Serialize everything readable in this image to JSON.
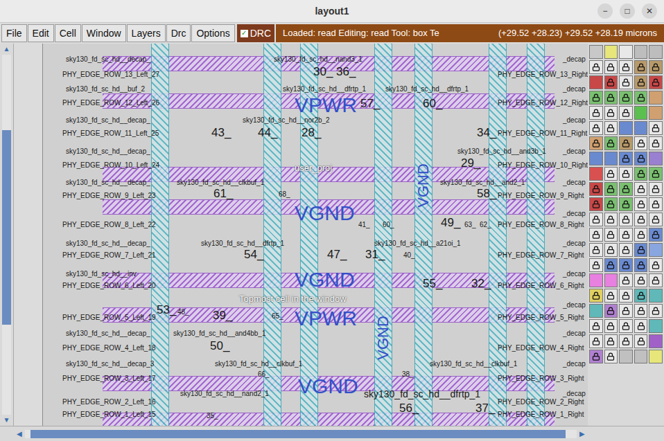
{
  "window": {
    "title": "layout1",
    "controls": [
      "−",
      "□",
      "✕"
    ]
  },
  "menu": [
    "File",
    "Edit",
    "Cell",
    "Window",
    "Layers",
    "Drc",
    "Options"
  ],
  "drc_toggle": {
    "label": "DRC",
    "checked": true,
    "check": "✓"
  },
  "status": {
    "left": "Loaded: read Editing: read Tool: box  Te",
    "right": "(+29.52 +28.23) +29.52 +28.19 microns"
  },
  "vertical_scroll": {
    "up": "▲",
    "down": "▼",
    "thumb_start": 0.21,
    "thumb_size": 0.54
  },
  "horizontal_scroll": {
    "left": "◀",
    "right": "▶",
    "thumb_start": 0.01,
    "thumb_size": 0.97
  },
  "labels": [
    {
      "text": "sky130_fd_sc_hd__decap_",
      "kind": "cell"
    },
    {
      "text": "sky130_fd_sc_hd__nand3_1",
      "kind": "cell"
    },
    {
      "text": "_decap",
      "kind": "cell"
    },
    {
      "text": "30_",
      "kind": "number"
    },
    {
      "text": "36_",
      "kind": "number"
    },
    {
      "text": "PHY_EDGE_ROW_13_Left_27",
      "kind": "edge"
    },
    {
      "text": "PHY_EDGE_ROW_13_Right",
      "kind": "edge"
    },
    {
      "text": "sky130_fd_sc_hd__buf_2",
      "kind": "cell"
    },
    {
      "text": "sky130_fd_sc_hd__dfrtp_1",
      "kind": "cell"
    },
    {
      "text": "sky130_fd_sc_hd__dfrtp_1",
      "kind": "cell"
    },
    {
      "text": "_decap",
      "kind": "cell"
    },
    {
      "text": "VPWR",
      "kind": "power"
    },
    {
      "text": "57_",
      "kind": "number"
    },
    {
      "text": "60_",
      "kind": "number"
    },
    {
      "text": "PHY_EDGE_ROW_12_Left_26",
      "kind": "edge"
    },
    {
      "text": "PHY_EDGE_ROW_12_Right",
      "kind": "edge"
    },
    {
      "text": "sky130_fd_sc_hd__decap_",
      "kind": "cell"
    },
    {
      "text": "sky130_fd_sc_hd__nor2b_2",
      "kind": "cell"
    },
    {
      "text": "_decap",
      "kind": "cell"
    },
    {
      "text": "43_",
      "kind": "number"
    },
    {
      "text": "44_",
      "kind": "number"
    },
    {
      "text": "28_",
      "kind": "number"
    },
    {
      "text": "34_",
      "kind": "number"
    },
    {
      "text": "PHY_EDGE_ROW_11_Left_25",
      "kind": "edge"
    },
    {
      "text": "PHY_EDGE_ROW_11_Right",
      "kind": "edge"
    },
    {
      "text": "sky130_fd_sc_hd__decap_",
      "kind": "cell"
    },
    {
      "text": "sky130_fd_sc_hd__and3b_1",
      "kind": "cell"
    },
    {
      "text": "_decap",
      "kind": "cell"
    },
    {
      "text": "29_",
      "kind": "number"
    },
    {
      "text": "PHY_EDGE_ROW_10_Left_24",
      "kind": "edge"
    },
    {
      "text": "PHY_EDGE_ROW_10_Right",
      "kind": "edge"
    },
    {
      "text": "user_proj",
      "kind": "overlay"
    },
    {
      "text": "VGND",
      "kind": "power-vertical"
    },
    {
      "text": "sky130_fd_sc_hd__decap_",
      "kind": "cell"
    },
    {
      "text": "sky130_fd_sc_hd__clkbuf_1",
      "kind": "cell"
    },
    {
      "text": "sky130_fd_sc_hd__and2_1",
      "kind": "cell"
    },
    {
      "text": "_decap",
      "kind": "cell"
    },
    {
      "text": "61_",
      "kind": "number"
    },
    {
      "text": "68_",
      "kind": "small-number"
    },
    {
      "text": "58_",
      "kind": "number"
    },
    {
      "text": "PHY_EDGE_ROW_9_Left_23",
      "kind": "edge"
    },
    {
      "text": "PHY_EDGE_ROW_9_Right",
      "kind": "edge"
    },
    {
      "text": "VGND",
      "kind": "power"
    },
    {
      "text": "_decap",
      "kind": "cell"
    },
    {
      "text": "41_",
      "kind": "small-number"
    },
    {
      "text": "60_",
      "kind": "small-number"
    },
    {
      "text": "49_",
      "kind": "number"
    },
    {
      "text": "63_",
      "kind": "small-number"
    },
    {
      "text": "62_",
      "kind": "small-number"
    },
    {
      "text": "PHY_EDGE_ROW_8_Left_22",
      "kind": "edge"
    },
    {
      "text": "PHY_EDGE_ROW_8_Right",
      "kind": "edge"
    },
    {
      "text": "sky130_fd_sc_hd__decap_",
      "kind": "cell"
    },
    {
      "text": "sky130_fd_sc_hd__dfrtp_1",
      "kind": "cell"
    },
    {
      "text": "sky130_fd_sc_hd__a21oi_1",
      "kind": "cell"
    },
    {
      "text": "_decap",
      "kind": "cell"
    },
    {
      "text": "54_",
      "kind": "number"
    },
    {
      "text": "47_",
      "kind": "number"
    },
    {
      "text": "31_",
      "kind": "number"
    },
    {
      "text": "40_",
      "kind": "small-number"
    },
    {
      "text": "PHY_EDGE_ROW_7_Left_21",
      "kind": "edge"
    },
    {
      "text": "PHY_EDGE_ROW_7_Right",
      "kind": "edge"
    },
    {
      "text": "sky130_fd_sc_hd__inv",
      "kind": "cell"
    },
    {
      "text": "_decap",
      "kind": "cell"
    },
    {
      "text": "VGND",
      "kind": "power"
    },
    {
      "text": "55_",
      "kind": "number"
    },
    {
      "text": "32_",
      "kind": "number"
    },
    {
      "text": "PHY_EDGE_ROW_6_Left_20",
      "kind": "edge"
    },
    {
      "text": "PHY_EDGE_ROW_6_Right",
      "kind": "edge"
    },
    {
      "text": "Topmost cell in the window",
      "kind": "overlay"
    },
    {
      "text": "_decap",
      "kind": "cell"
    },
    {
      "text": "VPWR",
      "kind": "power"
    },
    {
      "text": "53_",
      "kind": "number"
    },
    {
      "text": "48_",
      "kind": "small-number"
    },
    {
      "text": "39_",
      "kind": "number"
    },
    {
      "text": "65_",
      "kind": "small-number"
    },
    {
      "text": "PHY_EDGE_ROW_5_Left_19",
      "kind": "edge"
    },
    {
      "text": "PHY_EDGE_ROW_5_Right",
      "kind": "edge"
    },
    {
      "text": "VGND",
      "kind": "power-vertical"
    },
    {
      "text": "sky130_fd_sc_hd__decap_",
      "kind": "cell"
    },
    {
      "text": "sky130_fd_sc_hd__and4bb_1",
      "kind": "cell"
    },
    {
      "text": "_decap",
      "kind": "cell"
    },
    {
      "text": "50_",
      "kind": "number"
    },
    {
      "text": "PHY_EDGE_ROW_4_Left_18",
      "kind": "edge"
    },
    {
      "text": "PHY_EDGE_ROW_4_Right",
      "kind": "edge"
    },
    {
      "text": "sky130_fd_sc_hd__decap_3",
      "kind": "cell"
    },
    {
      "text": "sky130_fd_sc_hd__clkbuf_1",
      "kind": "cell"
    },
    {
      "text": "sky130_fd_sc_hd__clkbuf_1",
      "kind": "cell"
    },
    {
      "text": "_decap",
      "kind": "cell"
    },
    {
      "text": "66_",
      "kind": "small-number"
    },
    {
      "text": "38_",
      "kind": "small-number"
    },
    {
      "text": "VGND",
      "kind": "power"
    },
    {
      "text": "PHY_EDGE_ROW_3_Left_17",
      "kind": "edge"
    },
    {
      "text": "PHY_EDGE_ROW_3_Right",
      "kind": "edge"
    },
    {
      "text": "sky130_fd_sc_hd__nand2_1",
      "kind": "cell"
    },
    {
      "text": "sky130_fd_sc_hd__dfrtp_1",
      "kind": "cell-large"
    },
    {
      "text": "_decap",
      "kind": "cell"
    },
    {
      "text": "PHY_EDGE_ROW_2_Left_16",
      "kind": "edge"
    },
    {
      "text": "PHY_EDGE_ROW_2_Right",
      "kind": "edge"
    },
    {
      "text": "56_",
      "kind": "number"
    },
    {
      "text": "37_",
      "kind": "number"
    },
    {
      "text": "35_",
      "kind": "small-number"
    },
    {
      "text": "PHY_EDGE_ROW_1_Left_15",
      "kind": "edge"
    },
    {
      "text": "PHY_EDGE_ROW_1_Right",
      "kind": "edge"
    }
  ],
  "layer_palette": [
    [
      {
        "color": "#c8c8c8",
        "locked": false
      },
      {
        "color": "#e6e67a",
        "locked": false
      },
      {
        "color": "#e8e8e8",
        "locked": false
      },
      {
        "color": "#bdbdbd",
        "locked": false
      },
      {
        "color": "#bdbdbd",
        "locked": false
      }
    ],
    [
      {
        "color": "#e8e8e8",
        "locked": true
      },
      {
        "color": "#e8e8e8",
        "locked": true
      },
      {
        "color": "#e8e8e8",
        "locked": true
      },
      {
        "color": "#b89a6a",
        "locked": true
      },
      {
        "color": "#b89a6a",
        "locked": true
      }
    ],
    [
      {
        "color": "#c84848",
        "locked": false
      },
      {
        "color": "#c84848",
        "locked": true
      },
      {
        "color": "#e8e8e8",
        "locked": true
      },
      {
        "color": "#b89a6a",
        "locked": true
      },
      {
        "color": "#c84848",
        "locked": true
      }
    ],
    [
      {
        "color": "#7ac070",
        "locked": true
      },
      {
        "color": "#7ac070",
        "locked": true
      },
      {
        "color": "#7ac070",
        "locked": true
      },
      {
        "color": "#7ac070",
        "locked": true
      },
      {
        "color": "#d0a070",
        "locked": false
      }
    ],
    [
      {
        "color": "#e8e8e8",
        "locked": true
      },
      {
        "color": "#e8e8e8",
        "locked": true
      },
      {
        "color": "#e8e8e8",
        "locked": true
      },
      {
        "color": "#5cc050",
        "locked": false
      },
      {
        "color": "#d0a070",
        "locked": false
      }
    ],
    [
      {
        "color": "#e8e8e8",
        "locked": true
      },
      {
        "color": "#e8e8e8",
        "locked": true
      },
      {
        "color": "#6a8ad0",
        "locked": false
      },
      {
        "color": "#6a8ad0",
        "locked": false
      },
      {
        "color": "#e8e8e8",
        "locked": true
      }
    ],
    [
      {
        "color": "#d0a070",
        "locked": true
      },
      {
        "color": "#7ac070",
        "locked": true
      },
      {
        "color": "#b89a6a",
        "locked": true
      },
      {
        "color": "#e8e8e8",
        "locked": true
      },
      {
        "color": "#e8e8e8",
        "locked": true
      }
    ],
    [
      {
        "color": "#6a8ad0",
        "locked": false
      },
      {
        "color": "#6a8ad0",
        "locked": false
      },
      {
        "color": "#6a8ad0",
        "locked": true
      },
      {
        "color": "#6a8ad0",
        "locked": true
      },
      {
        "color": "#9a80d0",
        "locked": false
      }
    ],
    [
      {
        "color": "#d85050",
        "locked": false
      },
      {
        "color": "#e8e8e8",
        "locked": true
      },
      {
        "color": "#e8e8e8",
        "locked": true
      },
      {
        "color": "#7ac070",
        "locked": true
      },
      {
        "color": "#7ac070",
        "locked": true
      }
    ],
    [
      {
        "color": "#c84848",
        "locked": true
      },
      {
        "color": "#7ac070",
        "locked": true
      },
      {
        "color": "#7ac070",
        "locked": true
      },
      {
        "color": "#e8e8e8",
        "locked": true
      },
      {
        "color": "#e8e8e8",
        "locked": true
      }
    ],
    [
      {
        "color": "#c84848",
        "locked": true
      },
      {
        "color": "#7ac070",
        "locked": true
      },
      {
        "color": "#7ac070",
        "locked": true
      },
      {
        "color": "#e8e8e8",
        "locked": true
      },
      {
        "color": "#e8e8e8",
        "locked": true
      }
    ],
    [
      {
        "color": "#e8e8e8",
        "locked": true
      },
      {
        "color": "#e8e8e8",
        "locked": true
      },
      {
        "color": "#e8e8e8",
        "locked": true
      },
      {
        "color": "#e8e8e8",
        "locked": true
      },
      {
        "color": "#e8e8e8",
        "locked": true
      }
    ],
    [
      {
        "color": "#e8e8e8",
        "locked": true
      },
      {
        "color": "#e8e8e8",
        "locked": true
      },
      {
        "color": "#e8e8e8",
        "locked": true
      },
      {
        "color": "#e8e8e8",
        "locked": true
      },
      {
        "color": "#6a8ad0",
        "locked": true
      }
    ],
    [
      {
        "color": "#e8e8e8",
        "locked": true
      },
      {
        "color": "#e8e8e8",
        "locked": true
      },
      {
        "color": "#e8e8e8",
        "locked": true
      },
      {
        "color": "#6a8ad0",
        "locked": true
      },
      {
        "color": "#8aa6e0",
        "locked": false
      }
    ],
    [
      {
        "color": "#e8e8e8",
        "locked": true
      },
      {
        "color": "#6a8ad0",
        "locked": true
      },
      {
        "color": "#6a8ad0",
        "locked": true
      },
      {
        "color": "#6a8ad0",
        "locked": true
      },
      {
        "color": "#e8e8e8",
        "locked": true
      }
    ],
    [
      {
        "color": "#e880e0",
        "locked": false
      },
      {
        "color": "#e880e0",
        "locked": false
      },
      {
        "color": "#e8e8e8",
        "locked": true
      },
      {
        "color": "#e8e8e8",
        "locked": true
      },
      {
        "color": "#e8e8e8",
        "locked": true
      }
    ],
    [
      {
        "color": "#e0d060",
        "locked": true
      },
      {
        "color": "#e8e8e8",
        "locked": true
      },
      {
        "color": "#e8e8e8",
        "locked": true
      },
      {
        "color": "#60b8b8",
        "locked": true
      },
      {
        "color": "#60b8b8",
        "locked": false
      }
    ],
    [
      {
        "color": "#60b8b8",
        "locked": false
      },
      {
        "color": "#b080d0",
        "locked": true
      },
      {
        "color": "#e8e8e8",
        "locked": true
      },
      {
        "color": "#e8e8e8",
        "locked": true
      },
      {
        "color": "#e8e8e8",
        "locked": true
      }
    ],
    [
      {
        "color": "#e8e8e8",
        "locked": true
      },
      {
        "color": "#e8e8e8",
        "locked": true
      },
      {
        "color": "#e8e8e8",
        "locked": true
      },
      {
        "color": "#e8e8e8",
        "locked": true
      },
      {
        "color": "#60b8b8",
        "locked": false
      }
    ],
    [
      {
        "color": "#e8e8e8",
        "locked": true
      },
      {
        "color": "#e8e8e8",
        "locked": true
      },
      {
        "color": "#e8e8e8",
        "locked": true
      },
      {
        "color": "#e8e8e8",
        "locked": true
      },
      {
        "color": "#a060c8",
        "locked": false
      }
    ],
    [
      {
        "color": "#b080d0",
        "locked": true
      },
      {
        "color": "#e8e8e8",
        "locked": true
      },
      {
        "color": "#c0c0c0",
        "locked": false
      },
      {
        "color": "#c0c0c0",
        "locked": false
      },
      {
        "color": "#e6e67a",
        "locked": false
      }
    ]
  ]
}
